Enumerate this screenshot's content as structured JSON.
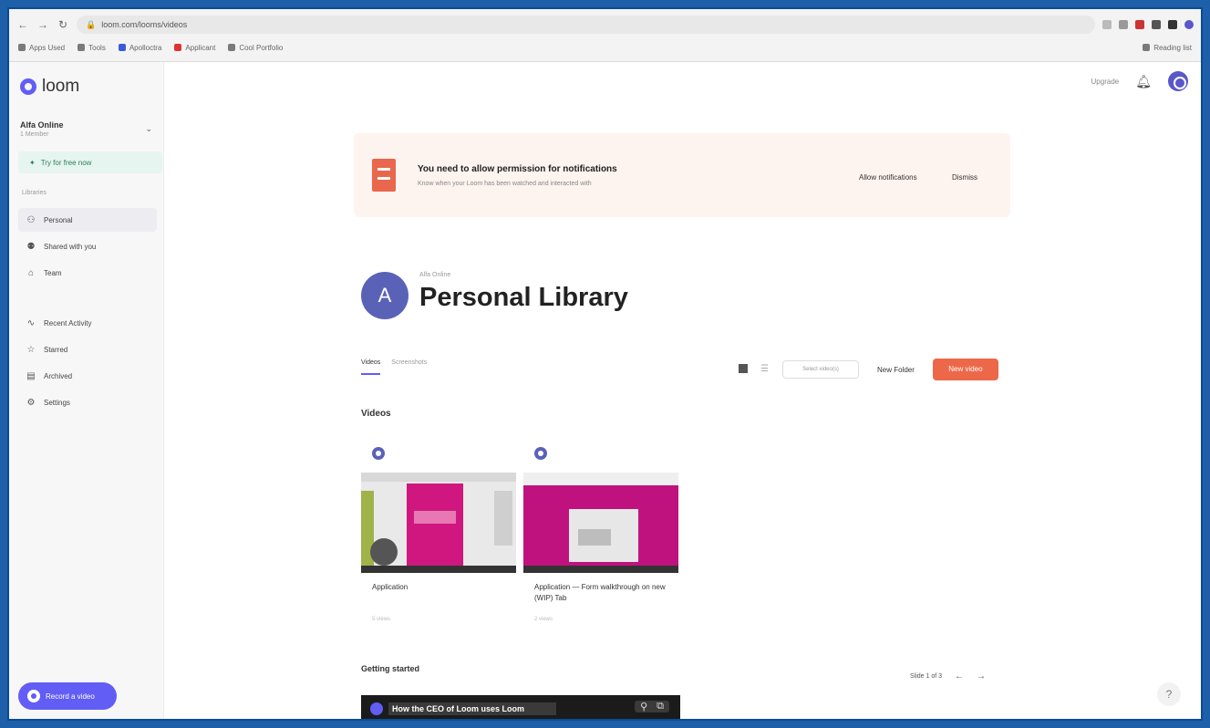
{
  "browser": {
    "url": "loom.com/looms/videos",
    "bookmarks": [
      "Apps Used",
      "Tools",
      "Apolloctra",
      "Applicant",
      "Cool Portfolio"
    ],
    "reading_list": "Reading list"
  },
  "sidebar": {
    "logo_text": "loom",
    "workspace_name": "Alfa Online",
    "workspace_sub": "1 Member",
    "trial_label": "Try for free now",
    "section_label": "Libraries",
    "items": [
      {
        "label": "Personal",
        "icon": "person-icon"
      },
      {
        "label": "Shared with you",
        "icon": "shared-icon"
      },
      {
        "label": "Team",
        "icon": "team-icon"
      },
      {
        "label": "Recent Activity",
        "icon": "activity-icon"
      },
      {
        "label": "Starred",
        "icon": "star-icon"
      },
      {
        "label": "Archived",
        "icon": "archive-icon"
      },
      {
        "label": "Settings",
        "icon": "gear-icon"
      }
    ],
    "record_button": "Record a video"
  },
  "topbar": {
    "upgrade": "Upgrade"
  },
  "banner": {
    "title": "You need to allow permission for notifications",
    "description": "Know when your Loom has been watched and interacted with",
    "allow": "Allow notifications",
    "dismiss": "Dismiss"
  },
  "library": {
    "avatar_letter": "A",
    "owner": "Alfa Online",
    "title": "Personal Library",
    "tabs": [
      "Videos",
      "Screenshots"
    ],
    "select_label": "Select video(s)",
    "new_folder": "New Folder",
    "new_video": "New video"
  },
  "videos": {
    "section_title": "Videos",
    "items": [
      {
        "title": "Application",
        "meta": "5 views"
      },
      {
        "title": "Application — Form walkthrough on new (WIP) Tab",
        "meta": "2 views"
      }
    ]
  },
  "getting_started": {
    "title": "Getting started",
    "pager": "Slide 1 of 3",
    "video_title": "How the CEO of Loom uses Loom"
  },
  "help_label": "?"
}
